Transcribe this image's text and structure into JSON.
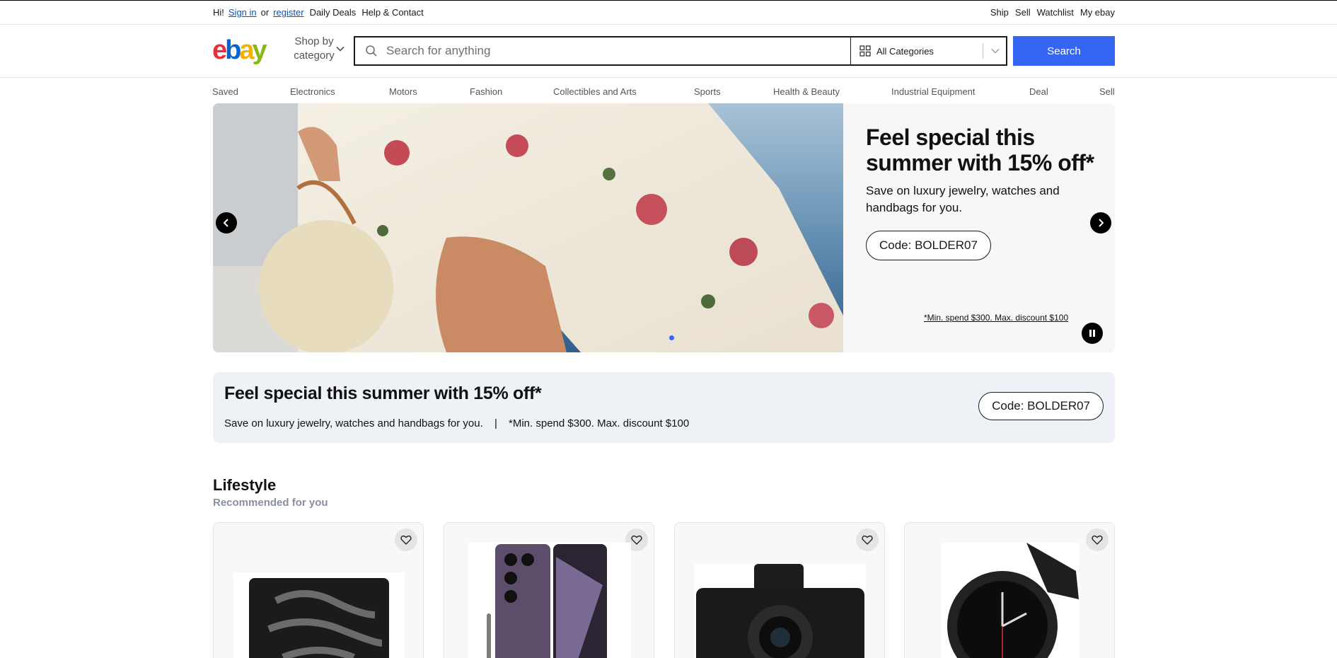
{
  "topbar": {
    "greeting": "Hi!",
    "sign_in": "Sign in",
    "or": "or",
    "register": "register",
    "links": [
      "Daily Deals",
      "Help & Contact"
    ],
    "right_links": [
      "Ship",
      "Sell",
      "Watchlist",
      "My ebay"
    ]
  },
  "header": {
    "logo_letters": [
      "e",
      "b",
      "a",
      "y"
    ],
    "logo_colors": [
      "#e53238",
      "#0064d2",
      "#f5af02",
      "#86b817"
    ],
    "shop_by": "Shop by",
    "category": "category",
    "search_placeholder": "Search for anything",
    "category_select": "All Categories",
    "search_button": "Search"
  },
  "nav": [
    "Saved",
    "Electronics",
    "Motors",
    "Fashion",
    "Collectibles and Arts",
    "Sports",
    "Health & Beauty",
    "Industrial Equipment",
    "Deal",
    "Sell"
  ],
  "hero": {
    "title": "Feel special this summer with 15% off*",
    "subtitle": "Save on luxury jewelry, watches and handbags for you.",
    "code": "Code: BOLDER07",
    "terms": "*Min. spend $300. Max. discount $100"
  },
  "promo": {
    "title": "Feel special this summer with 15% off*",
    "text_a": "Save on luxury jewelry, watches and handbags for you.",
    "divider": "|",
    "text_b": "*Min. spend $300. Max. discount $100",
    "code": "Code: BOLDER07"
  },
  "section": {
    "title": "Lifestyle",
    "subtitle": "Recommended for you"
  },
  "colors": {
    "accent": "#3665f3",
    "promo_bg": "#eef2f6"
  }
}
